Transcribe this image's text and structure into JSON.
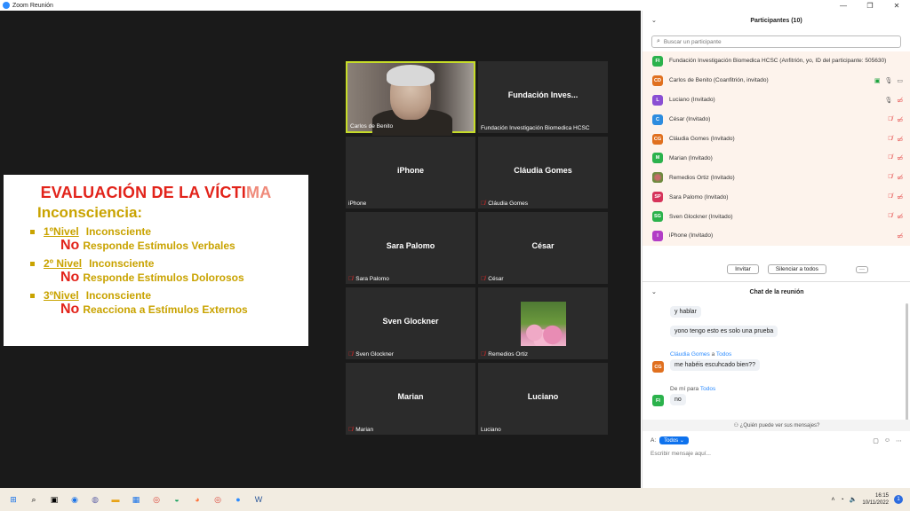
{
  "window": {
    "title": "Zoom Reunión",
    "controls": [
      "—",
      "❐",
      "✕"
    ]
  },
  "slide": {
    "title_main": "EVALUACIÓN DE LA VÍCTI",
    "title_fade": "MA",
    "subtitle": "Inconsciencia:",
    "levels": [
      {
        "num": "1ºNivel",
        "head": "Inconsciente",
        "no": "No",
        "text": "Responde Estímulos Verbales"
      },
      {
        "num": "2º Nivel",
        "head": "Inconsciente",
        "no": "No",
        "text": "Responde Estímulos Dolorosos"
      },
      {
        "num": "3ºNivel",
        "head": "Inconsciente",
        "no": "No",
        "text": "Reacciona a Estímulos Externos"
      }
    ]
  },
  "tiles": [
    {
      "center": "",
      "label": "Carlos de Benito",
      "muted": false
    },
    {
      "center": "Fundación Inves...",
      "label": "Fundación Investigación Biomedica HCSC",
      "muted": false
    },
    {
      "center": "iPhone",
      "label": "iPhone",
      "muted": false
    },
    {
      "center": "Cláudia Gomes",
      "label": "Cláudia Gomes",
      "muted": true
    },
    {
      "center": "Sara Palomo",
      "label": "Sara Palomo",
      "muted": true
    },
    {
      "center": "César",
      "label": "César",
      "muted": true
    },
    {
      "center": "Sven Glockner",
      "label": "Sven Glockner",
      "muted": true
    },
    {
      "center": "",
      "label": "Remedios Ortiz",
      "muted": true
    },
    {
      "center": "Marian",
      "label": "Marian",
      "muted": true
    },
    {
      "center": "Luciano",
      "label": "Luciano",
      "muted": false
    }
  ],
  "participants": {
    "title": "Participantes (10)",
    "search_placeholder": "Buscar un participante",
    "list": [
      {
        "initials": "FI",
        "color": "#2bb24c",
        "name": "Fundación Investigación Biomedica HCSC (Anfitrión, yo, ID del participante: 505630)",
        "icons": []
      },
      {
        "initials": "CD",
        "color": "#e0701f",
        "name": "Carlos de Benito (Coanfitrión, invitado)",
        "icons": [
          "share",
          "mic",
          "cam"
        ]
      },
      {
        "initials": "L",
        "color": "#8a4fd3",
        "name": "Luciano (Invitado)",
        "icons": [
          "mic",
          "cam-off"
        ]
      },
      {
        "initials": "C",
        "color": "#2d8cdf",
        "name": "César (Invitado)",
        "icons": [
          "mic-off",
          "cam-off"
        ]
      },
      {
        "initials": "CG",
        "color": "#e0701f",
        "name": "Cláudia Gomes (Invitado)",
        "icons": [
          "mic-off",
          "cam-off"
        ]
      },
      {
        "initials": "M",
        "color": "#2bb24c",
        "name": "Marian (Invitado)",
        "icons": [
          "mic-off",
          "cam-off"
        ]
      },
      {
        "initials": "",
        "color": "#9a6b4a",
        "name": "Remedios Ortiz (Invitado)",
        "icons": [
          "mic-off",
          "cam-off"
        ]
      },
      {
        "initials": "SP",
        "color": "#d6335a",
        "name": "Sara Palomo (Invitado)",
        "icons": [
          "mic-off",
          "cam-off"
        ]
      },
      {
        "initials": "SG",
        "color": "#2bb24c",
        "name": "Sven Glockner (Invitado)",
        "icons": [
          "mic-off",
          "cam-off"
        ]
      },
      {
        "initials": "I",
        "color": "#b23dc6",
        "name": "iPhone (Invitado)",
        "icons": [
          "cam-off"
        ]
      }
    ],
    "invite_label": "Invitar",
    "mute_all_label": "Silenciar a todos",
    "more_label": "···"
  },
  "chat": {
    "title": "Chat de la reunión",
    "msg1": "y hablar",
    "msg2": "yono tengo esto es solo una prueba",
    "sender2_name": "Cláudia Gomes",
    "sender2_mid": " a ",
    "sender2_to": "Todos",
    "msg3": "me habéis escuhcado bien??",
    "avatar3": "CG",
    "sender3_from": "De mí para ",
    "sender3_to": "Todos",
    "avatar4": "FI",
    "msg4": "no",
    "who_can_see": "¿Quién puede ver sus mensajes?",
    "to_label": "A:",
    "to_value": "Todos ⌄",
    "compose_placeholder": "Escribir mensaje aquí..."
  },
  "taskbar": {
    "time": "16:15",
    "date": "10/11/2022",
    "notifications": "1"
  }
}
